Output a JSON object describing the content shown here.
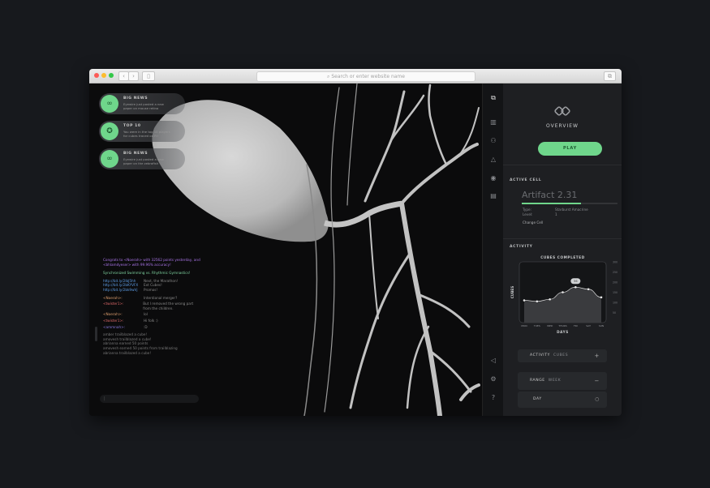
{
  "browser": {
    "address_placeholder": "Search or enter website name"
  },
  "notifications": [
    {
      "title": "BIG NEWS",
      "text": "Eyewire just posted a new paper on mouse retina"
    },
    {
      "title": "TOP 10",
      "text": "You were in the top 10 players for cubes traced on Fri"
    },
    {
      "title": "BIG NEWS",
      "text": "Eyewire just posted a new paper on the zebrafish"
    }
  ],
  "chat": {
    "announcement": "Congrats to <Noerah> with 32562 points yesterday, and <bhlamdyeser> with 99.96% accuracy!",
    "topic": "Synchronized Swimming vs. Rhythmic Gymnastics!",
    "links": [
      {
        "url": "http://bit.ly/2lbJ5hh",
        "text": "Next, the Marathon!"
      },
      {
        "url": "http://bit.ly/2bKYVFX",
        "text": "Ext Cubes!"
      },
      {
        "url": "http://bit.ly/2bk9wVj",
        "text": "Promos!"
      }
    ],
    "messages": [
      {
        "user": "<Noerah>:",
        "text": "Intentional merger?"
      },
      {
        "user": "<twister1>:",
        "text": "But I removed the wrong part from the children."
      },
      {
        "user": "<Noerah>:",
        "text": "lol"
      },
      {
        "user": "<twister1>:",
        "text": "Hi folk :)"
      },
      {
        "user": "<ammnah>:",
        "text": ":D"
      }
    ],
    "events": [
      "amber trailblazed a cube!",
      "amovesh trailblazed a cube!",
      "abrianna earned 50 points",
      "amovesh earned 50 points from trailblazing",
      "abrianna trailblazed a cube!"
    ],
    "input_value": "|"
  },
  "panel": {
    "title": "OVERVIEW",
    "play_label": "PLAY",
    "active_cell_label": "ACTIVE CELL",
    "cell_name": "Artifact 2.31",
    "cell_progress": 0.62,
    "type_label": "Type:",
    "type_value": "Starburst Amacrine",
    "level_label": "Level:",
    "level_value": "1",
    "change_cell": "Change Cell",
    "activity_label": "ACTIVITY",
    "activity_tab": "ACTIVITY",
    "activity_value": "CUBES",
    "range_label": "RANGE",
    "range_value": "WEEK",
    "day_label": "DAY"
  },
  "chart_data": {
    "type": "area",
    "title": "CUBES COMPLETED",
    "xlabel": "DAYS",
    "ylabel": "CUBES",
    "categories": [
      "MON",
      "TUES",
      "WED",
      "THURS",
      "FRI",
      "SAT",
      "SUN"
    ],
    "x": [
      0,
      1,
      2,
      3,
      4,
      5,
      6
    ],
    "y": [
      110,
      105,
      115,
      150,
      175,
      165,
      125
    ],
    "ytick_labels": [
      "300",
      "250",
      "200",
      "150",
      "100",
      "50"
    ],
    "ylim": [
      0,
      300
    ],
    "highlight": {
      "index": 4,
      "label": "56"
    }
  },
  "colors": {
    "accent": "#6fd68b",
    "chat_purple": "#a874e6",
    "chat_green": "#7fd3a0",
    "chat_link": "#5d9de6",
    "chat_user": "#e0a070",
    "chat_user2": "#e06a6a",
    "panel_bg": "#1e1f22"
  }
}
